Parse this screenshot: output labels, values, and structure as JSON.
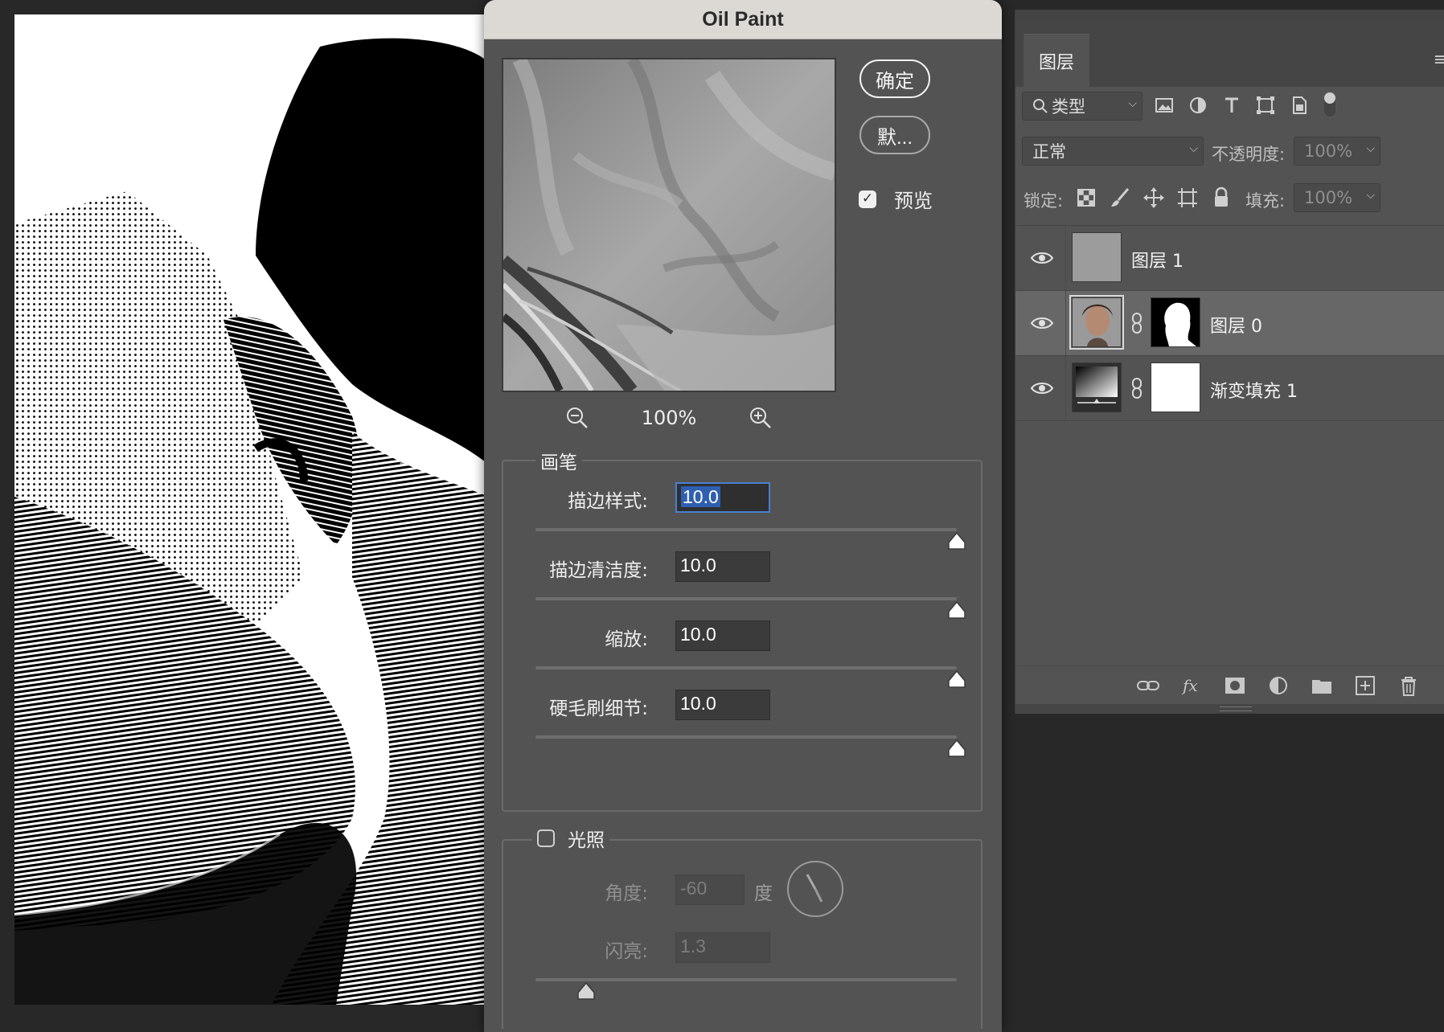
{
  "dialog": {
    "title": "Oil Paint",
    "ok_label": "确定",
    "default_label": "默...",
    "preview_label": "预览",
    "preview_checked": true,
    "zoom_level": "100%"
  },
  "brush": {
    "group_label": "画笔",
    "params": [
      {
        "label": "描边样式:",
        "value": "10.0",
        "fraction": 1.0
      },
      {
        "label": "描边清洁度:",
        "value": "10.0",
        "fraction": 1.0
      },
      {
        "label": "缩放:",
        "value": "10.0",
        "fraction": 1.0
      },
      {
        "label": "硬毛刷细节:",
        "value": "10.0",
        "fraction": 1.0
      }
    ]
  },
  "lighting": {
    "group_label": "光照",
    "checked": false,
    "angle_label": "角度:",
    "angle_value": "-60",
    "angle_unit": "度",
    "shine_label": "闪亮:",
    "shine_value": "1.3",
    "shine_fraction": 0.12
  },
  "layers_panel": {
    "tab_label": "图层",
    "filter_label": "类型",
    "blend_mode": "正常",
    "opacity_label": "不透明度:",
    "opacity_value": "100%",
    "lock_label": "锁定:",
    "fill_label": "填充:",
    "fill_value": "100%",
    "layers": [
      {
        "name": "图层 1",
        "visible": true,
        "selected": false
      },
      {
        "name": "图层 0",
        "visible": true,
        "selected": true
      },
      {
        "name": "渐变填充 1",
        "visible": true,
        "selected": false
      }
    ]
  },
  "colors": {
    "app_bg": "#282828",
    "dialog_bg": "#535353",
    "titlebar": "#dcd9d5",
    "focus_blue": "#4a7fd1",
    "selected_layer": "#676767"
  },
  "icons": {
    "zoom_out": "zoom-out-icon",
    "zoom_in": "zoom-in-icon",
    "eye": "eye-icon",
    "chain": "chain-link-icon",
    "lock": "lock-icon"
  }
}
